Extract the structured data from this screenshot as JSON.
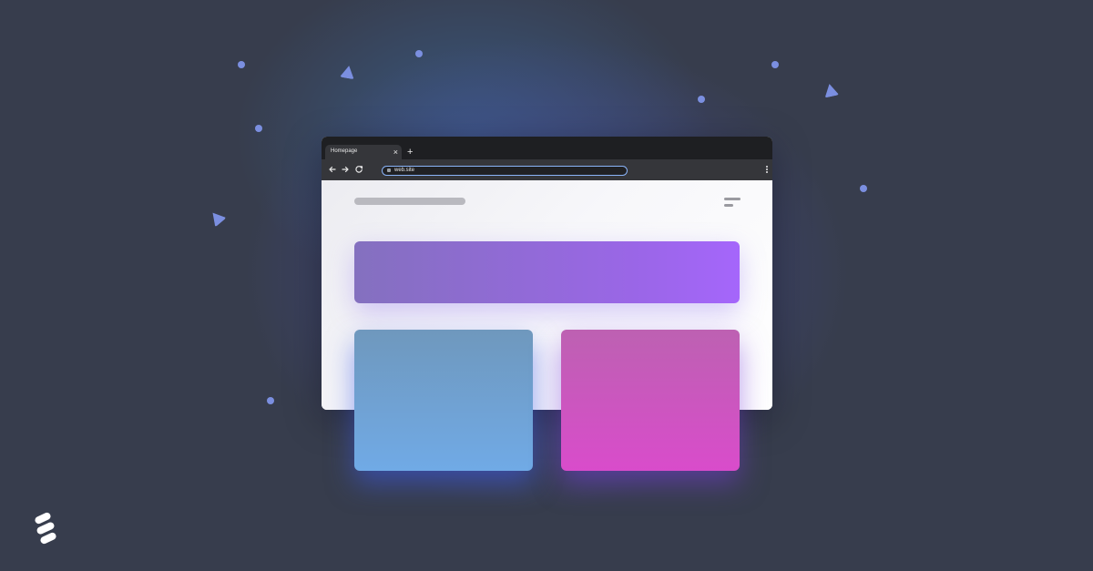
{
  "browser": {
    "tab": {
      "label": "Homepage",
      "close_glyph": "×"
    },
    "new_tab_glyph": "+",
    "address_bar": {
      "url": "web.site"
    },
    "icons": [
      "back-arrow-icon",
      "forward-arrow-icon",
      "reload-icon",
      "lock-icon",
      "more-vert-icon"
    ]
  },
  "colors": {
    "background": "#373d4d",
    "accent_dots": "#7b8fe0",
    "hero_gradient": [
      "#8470bf",
      "#a566fb"
    ],
    "card_left_gradient": [
      "#6f98bd",
      "#70aae6"
    ],
    "card_right_gradient": [
      "#bd61b2",
      "#d94ccb"
    ]
  }
}
